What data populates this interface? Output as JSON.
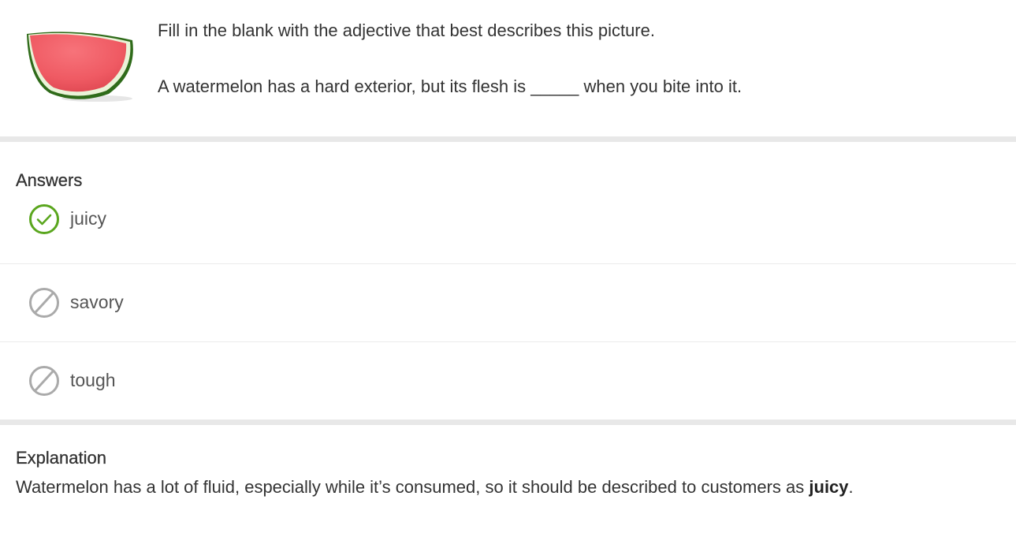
{
  "question": {
    "image_icon": "watermelon-slice-image",
    "prompt": "Fill in the blank with the adjective that best describes this picture.",
    "sentence": "A watermelon has a hard exterior, but its flesh is _____ when you bite into it."
  },
  "answers": {
    "title": "Answers",
    "items": [
      {
        "label": "juicy",
        "status": "correct",
        "icon": "check-circle-icon",
        "color": "#5aa61e"
      },
      {
        "label": "savory",
        "status": "incorrect",
        "icon": "prohibited-circle-icon",
        "color": "#aaaaaa"
      },
      {
        "label": "tough",
        "status": "incorrect",
        "icon": "prohibited-circle-icon",
        "color": "#aaaaaa"
      }
    ]
  },
  "explanation": {
    "title": "Explanation",
    "text_before": "Watermelon has a lot of fluid, especially while it’s consumed, so it should be described to customers as ",
    "highlight": "juicy",
    "text_after": "."
  },
  "colors": {
    "divider": "#e8e8e8",
    "correct": "#5aa61e",
    "neutral": "#aaaaaa",
    "text": "#333333"
  }
}
